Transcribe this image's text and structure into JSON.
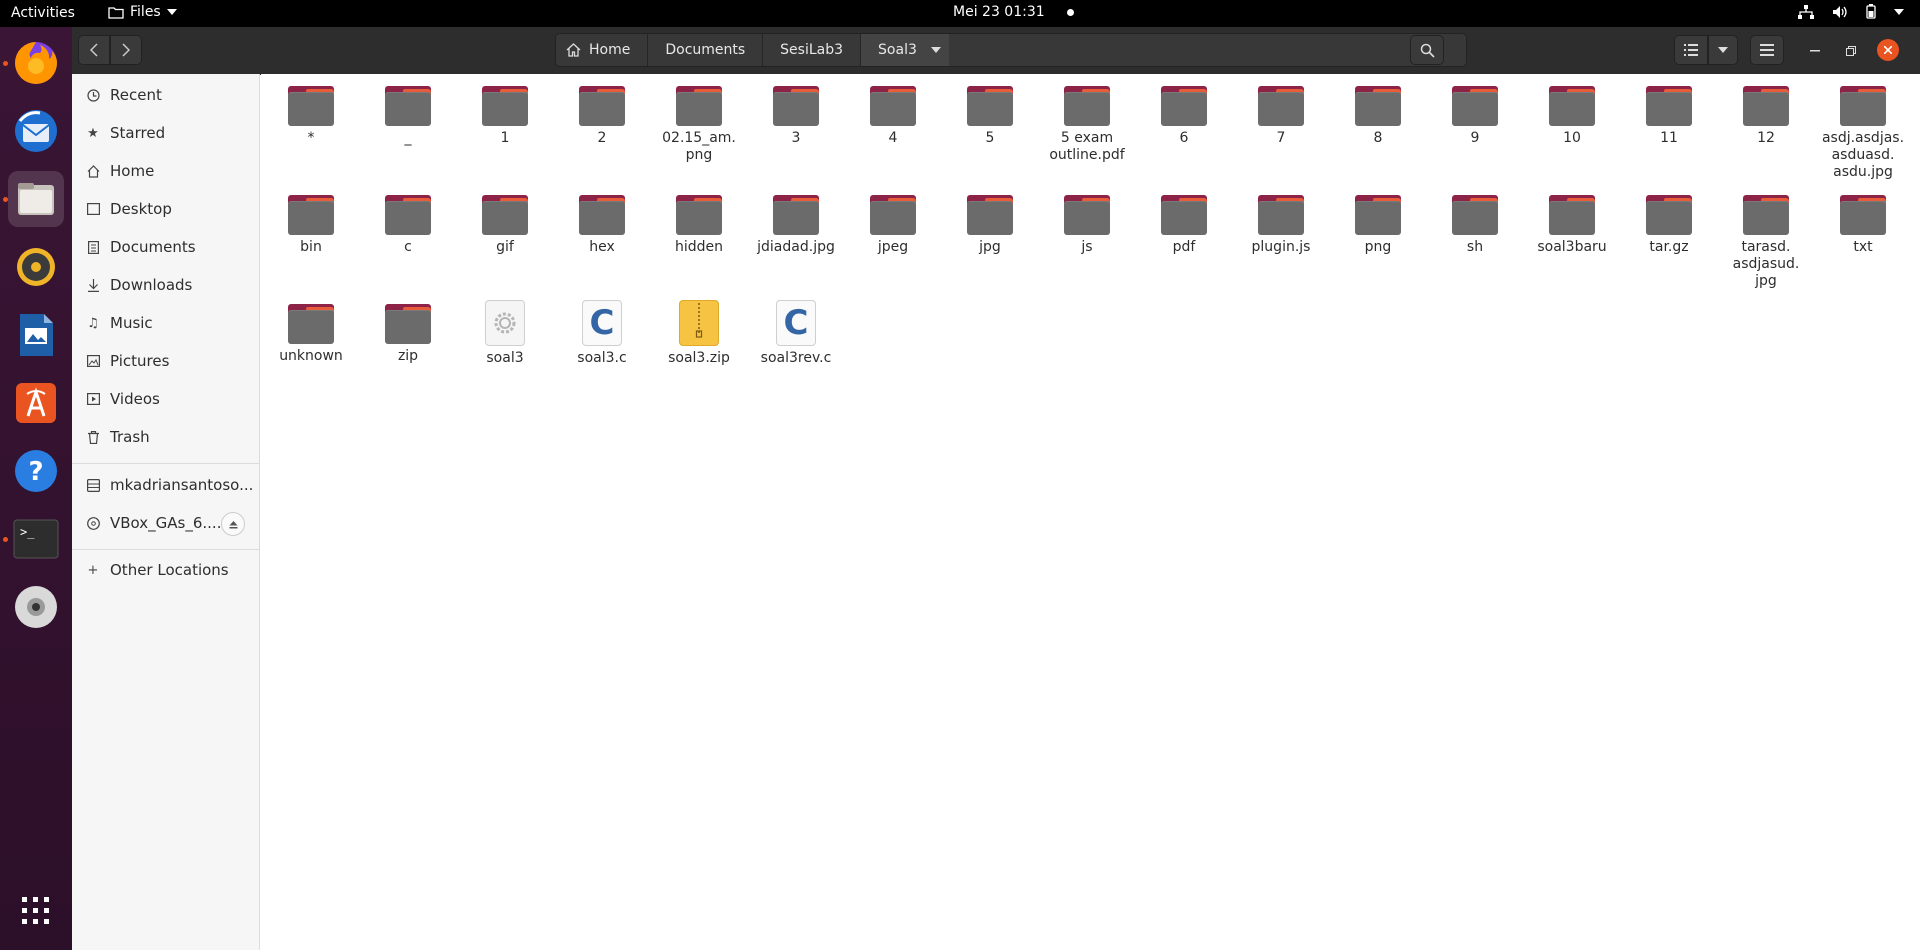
{
  "topbar": {
    "activities": "Activities",
    "app_menu": "Files",
    "clock": "Mei 23  01:31"
  },
  "dock": {
    "apps": [
      "firefox-icon",
      "thunderbird-icon",
      "files-icon",
      "rhythmbox-icon",
      "writer-icon",
      "app-center-icon",
      "help-icon",
      "terminal-icon",
      "disc-icon"
    ],
    "show_apps": "apps-grid-icon"
  },
  "header": {
    "breadcrumbs": [
      "Home",
      "Documents",
      "SesiLab3",
      "Soal3"
    ]
  },
  "sidebar": {
    "items": [
      {
        "label": "Recent",
        "icon": "clock-icon"
      },
      {
        "label": "Starred",
        "icon": "star-icon"
      },
      {
        "label": "Home",
        "icon": "home-icon"
      },
      {
        "label": "Desktop",
        "icon": "desktop-icon"
      },
      {
        "label": "Documents",
        "icon": "document-icon"
      },
      {
        "label": "Downloads",
        "icon": "download-icon"
      },
      {
        "label": "Music",
        "icon": "music-icon"
      },
      {
        "label": "Pictures",
        "icon": "picture-icon"
      },
      {
        "label": "Videos",
        "icon": "video-icon"
      },
      {
        "label": "Trash",
        "icon": "trash-icon"
      }
    ],
    "devices": [
      {
        "label": "mkadriansantoso...",
        "icon": "drive-icon"
      },
      {
        "label": "VBox_GAs_6....",
        "icon": "optical-disc-icon"
      }
    ],
    "other": "Other Locations"
  },
  "files": [
    {
      "name": "*",
      "type": "folder"
    },
    {
      "name": "_",
      "type": "folder"
    },
    {
      "name": "1",
      "type": "folder"
    },
    {
      "name": "2",
      "type": "folder"
    },
    {
      "name": "02.15_am.\npng",
      "type": "folder"
    },
    {
      "name": "3",
      "type": "folder"
    },
    {
      "name": "4",
      "type": "folder"
    },
    {
      "name": "5",
      "type": "folder"
    },
    {
      "name": "5 exam\noutline.pdf",
      "type": "folder"
    },
    {
      "name": "6",
      "type": "folder"
    },
    {
      "name": "7",
      "type": "folder"
    },
    {
      "name": "8",
      "type": "folder"
    },
    {
      "name": "9",
      "type": "folder"
    },
    {
      "name": "10",
      "type": "folder"
    },
    {
      "name": "11",
      "type": "folder"
    },
    {
      "name": "12",
      "type": "folder"
    },
    {
      "name": "asdj.asdjas.\nasduasd.\nasdu.jpg",
      "type": "folder"
    },
    {
      "name": "bin",
      "type": "folder"
    },
    {
      "name": "c",
      "type": "folder"
    },
    {
      "name": "gif",
      "type": "folder"
    },
    {
      "name": "hex",
      "type": "folder"
    },
    {
      "name": "hidden",
      "type": "folder"
    },
    {
      "name": "jdiadad.jpg",
      "type": "folder"
    },
    {
      "name": "jpeg",
      "type": "folder"
    },
    {
      "name": "jpg",
      "type": "folder"
    },
    {
      "name": "js",
      "type": "folder"
    },
    {
      "name": "pdf",
      "type": "folder"
    },
    {
      "name": "plugin.js",
      "type": "folder"
    },
    {
      "name": "png",
      "type": "folder"
    },
    {
      "name": "sh",
      "type": "folder"
    },
    {
      "name": "soal3baru",
      "type": "folder"
    },
    {
      "name": "tar.gz",
      "type": "folder"
    },
    {
      "name": "tarasd.\nasdjasud.\njpg",
      "type": "folder"
    },
    {
      "name": "txt",
      "type": "folder"
    },
    {
      "name": "unknown",
      "type": "folder"
    },
    {
      "name": "zip",
      "type": "folder"
    },
    {
      "name": "soal3",
      "type": "executable"
    },
    {
      "name": "soal3.c",
      "type": "c-source"
    },
    {
      "name": "soal3.zip",
      "type": "zip"
    },
    {
      "name": "soal3rev.c",
      "type": "c-source"
    }
  ],
  "colors": {
    "accent": "#e95420",
    "folder_tab": "#8d2447",
    "folder_body": "#6b6b6b",
    "c_letter": "#3465a4",
    "zip_yellow": "#f6c343"
  }
}
